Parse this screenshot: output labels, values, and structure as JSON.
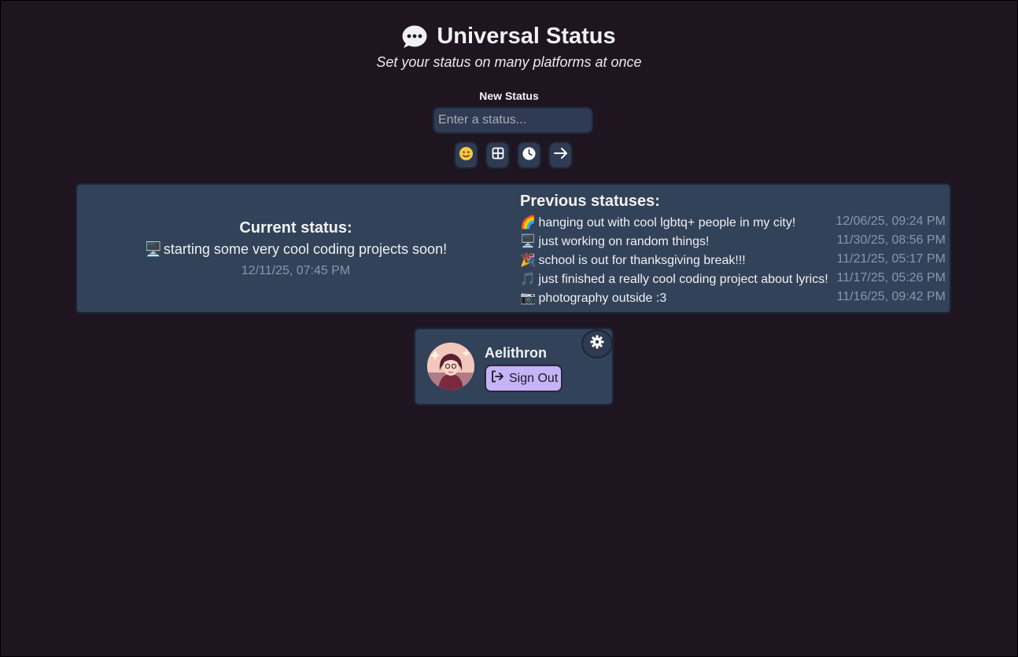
{
  "header": {
    "title": "Universal Status",
    "subtitle": "Set your status on many platforms at once"
  },
  "new_status": {
    "label": "New Status",
    "placeholder": "Enter a status...",
    "tools": [
      "emoji-icon",
      "grid-icon",
      "clock-icon",
      "arrow-right-icon"
    ]
  },
  "current": {
    "heading": "Current status:",
    "emoji": "🖥️",
    "text": "starting some very cool coding projects soon!",
    "time": "12/11/25, 07:45 PM"
  },
  "previous": {
    "heading": "Previous statuses:",
    "items": [
      {
        "emoji": "🌈",
        "text": "hanging out with cool lgbtq+ people in my city!",
        "time": "12/06/25, 09:24 PM"
      },
      {
        "emoji": "🖥️",
        "text": "just working on random things!",
        "time": "11/30/25, 08:56 PM"
      },
      {
        "emoji": "🎉",
        "text": "school is out for thanksgiving break!!!",
        "time": "11/21/25, 05:17 PM"
      },
      {
        "emoji": "🎵",
        "text": "just finished a really cool coding project about lyrics!",
        "time": "11/17/25, 05:26 PM"
      },
      {
        "emoji": "📷",
        "text": "photography outside :3",
        "time": "11/16/25, 09:42 PM"
      }
    ]
  },
  "profile": {
    "username": "Aelithron",
    "signout_label": "Sign Out"
  },
  "colors": {
    "background": "#1f1521",
    "panel": "#324259",
    "accent": "#c7b3f7",
    "muted_text": "#8c96a8"
  }
}
